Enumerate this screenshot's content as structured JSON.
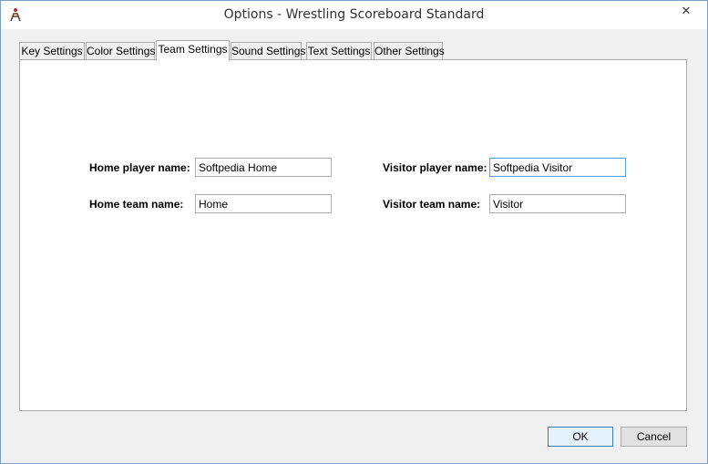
{
  "window": {
    "title": "Options - Wrestling Scoreboard Standard",
    "close_glyph": "✕"
  },
  "tabs": [
    {
      "label": "Key Settings"
    },
    {
      "label": "Color Settings"
    },
    {
      "label": "Team Settings"
    },
    {
      "label": "Sound Settings"
    },
    {
      "label": "Text Settings"
    },
    {
      "label": "Other Settings"
    }
  ],
  "active_tab": "Team Settings",
  "fields": {
    "home_player": {
      "label": "Home player name:",
      "value": "Softpedia Home"
    },
    "home_team": {
      "label": "Home team name:",
      "value": "Home"
    },
    "visitor_player": {
      "label": "Visitor player name:",
      "value": "Softpedia Visitor"
    },
    "visitor_team": {
      "label": "Visitor team name:",
      "value": "Visitor"
    }
  },
  "buttons": {
    "ok": "OK",
    "cancel": "Cancel"
  },
  "colors": {
    "focus_border": "#569de5",
    "default_button": "#e5f1fb"
  }
}
